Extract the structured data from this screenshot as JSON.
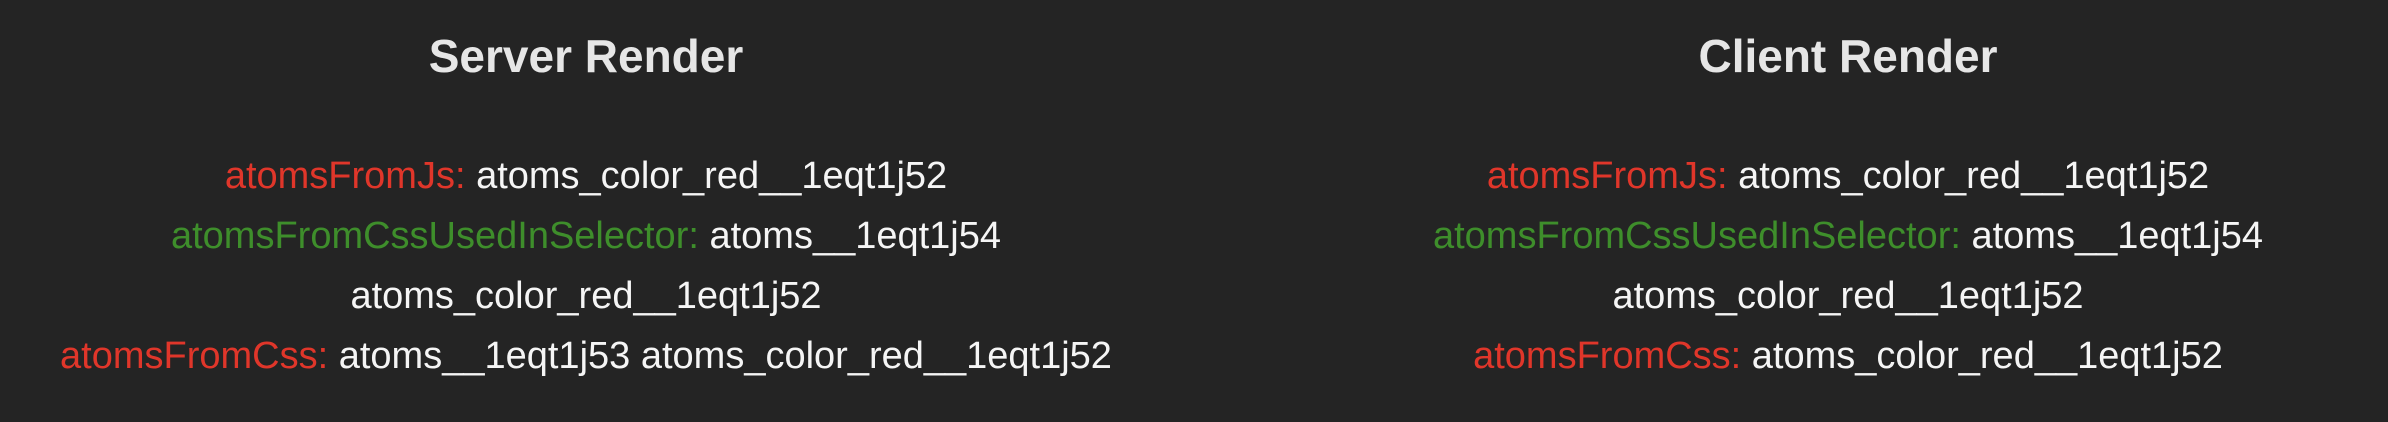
{
  "server": {
    "title": "Server Render",
    "rows": [
      {
        "key": "atomsFromJs:",
        "value": " atoms_color_red__1eqt1j52",
        "key_color": "#e0362a"
      },
      {
        "key": "atomsFromCssUsedInSelector:",
        "value": " atoms__1eqt1j54",
        "key_color": "#3e8e2b"
      },
      {
        "key": "",
        "value": "atoms_color_red__1eqt1j52"
      },
      {
        "key": "atomsFromCss:",
        "value": " atoms__1eqt1j53 atoms_color_red__1eqt1j52",
        "key_color": "#e0362a"
      }
    ]
  },
  "client": {
    "title": "Client Render",
    "rows": [
      {
        "key": "atomsFromJs:",
        "value": " atoms_color_red__1eqt1j52",
        "key_color": "#e0362a"
      },
      {
        "key": "atomsFromCssUsedInSelector:",
        "value": " atoms__1eqt1j54",
        "key_color": "#3e8e2b"
      },
      {
        "key": "",
        "value": "atoms_color_red__1eqt1j52"
      },
      {
        "key": "atomsFromCss:",
        "value": " atoms_color_red__1eqt1j52",
        "key_color": "#e0362a"
      }
    ]
  }
}
